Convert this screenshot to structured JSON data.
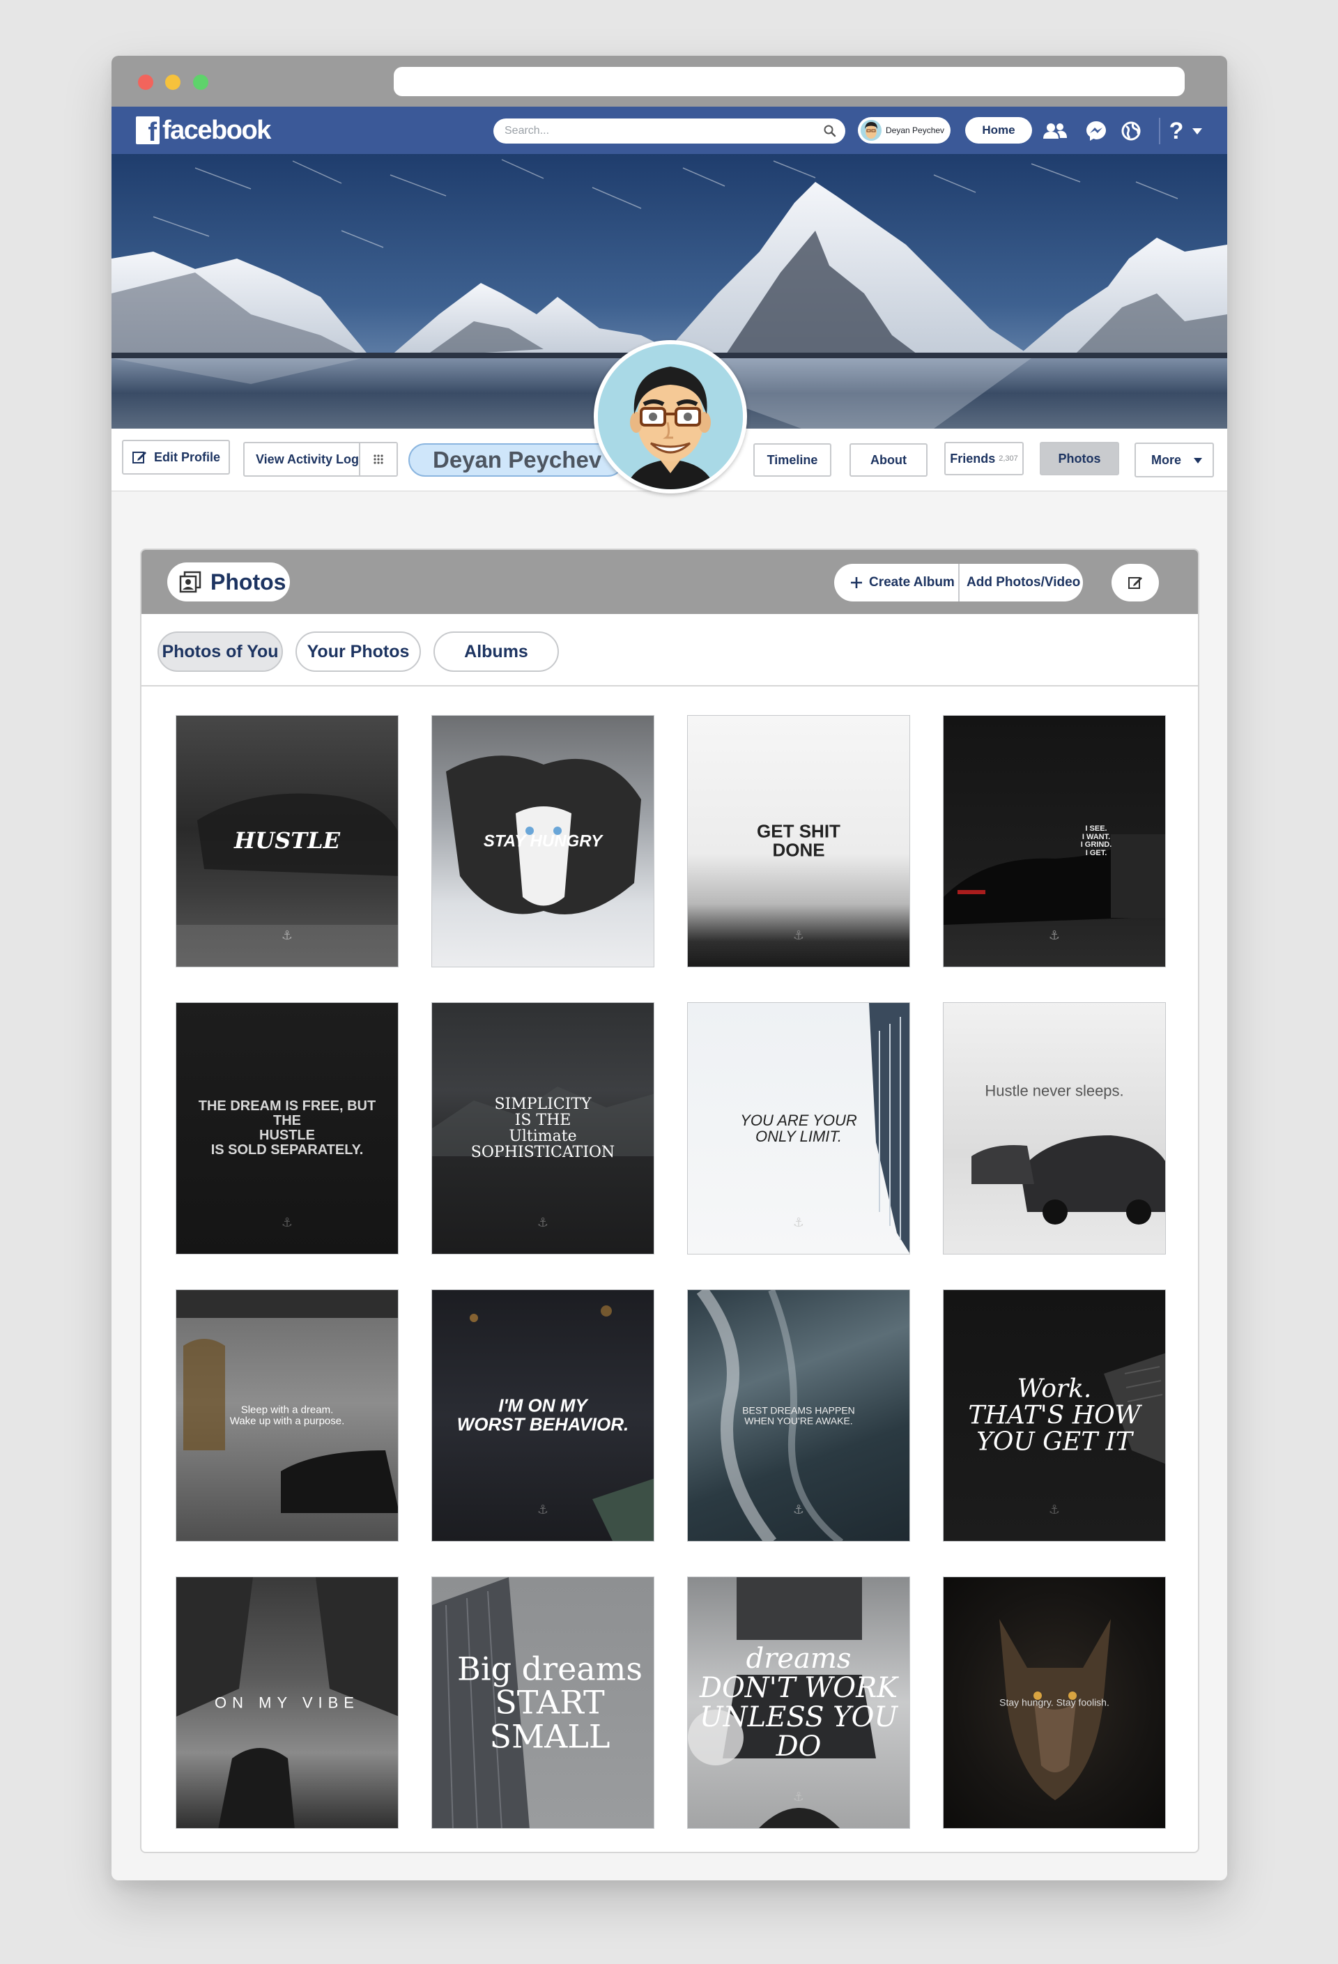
{
  "browser": {
    "url": ""
  },
  "topbar": {
    "brand": "facebook",
    "brand_letter": "f",
    "search_placeholder": "Search...",
    "user_name": "Deyan Peychev",
    "home_label": "Home",
    "help_label": "?"
  },
  "profile": {
    "name": "Deyan Peychev",
    "edit_profile": "Edit Profile",
    "activity_log": "View Activity Log",
    "tabs": {
      "timeline": "Timeline",
      "about": "About",
      "friends": "Friends",
      "friends_count": "2,307",
      "photos": "Photos",
      "more": "More"
    }
  },
  "photos": {
    "title": "Photos",
    "create_album": "Create Album",
    "add_photos": "Add Photos/Video",
    "subtabs": [
      "Photos of You",
      "Your Photos",
      "Albums"
    ],
    "anchor_glyph": "⚓",
    "tiles": [
      {
        "caption": "HUSTLE"
      },
      {
        "caption": "STAY HUNGRY"
      },
      {
        "caption": "GET SHIT\nDONE"
      },
      {
        "caption": "I SEE.\nI WANT.\nI GRIND.\nI GET."
      },
      {
        "caption": "THE DREAM IS FREE, BUT THE\nHUSTLE\nIS SOLD SEPARATELY."
      },
      {
        "caption": "SIMPLICITY\nIS THE\nUltimate\nSOPHISTICATION"
      },
      {
        "caption": "YOU ARE YOUR\nONLY LIMIT."
      },
      {
        "caption": "Hustle never sleeps."
      },
      {
        "caption": "Sleep with a dream.\nWake up with a purpose."
      },
      {
        "caption": "I'M ON MY\nWORST BEHAVIOR."
      },
      {
        "caption": "BEST DREAMS HAPPEN\nWHEN YOU'RE AWAKE."
      },
      {
        "caption": "Work.\nTHAT'S HOW YOU GET IT"
      },
      {
        "caption": "ON MY VIBE"
      },
      {
        "caption": "Big dreams\nSTART SMALL"
      },
      {
        "caption": "dreams\nDON'T WORK UNLESS YOU DO"
      },
      {
        "caption": "Stay hungry. Stay foolish."
      }
    ]
  },
  "colors": {
    "fb_blue": "#3b5998",
    "navy_text": "#1d3461",
    "chrome_gray": "#9c9c9c"
  }
}
